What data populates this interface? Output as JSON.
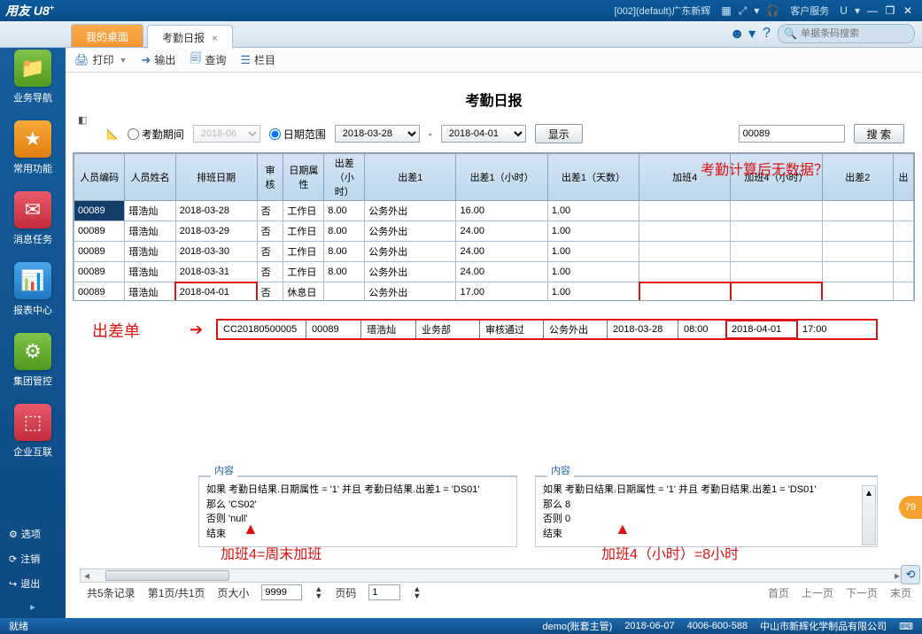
{
  "titlebar": {
    "brand": "用友",
    "brand2": "U8",
    "plus": "+",
    "org_info": "[002](default)广东新辉",
    "service": "客户服务",
    "u_letter": "U"
  },
  "tabs": {
    "desktop": "我的桌面",
    "report": "考勤日报"
  },
  "search_placeholder": "单据条码搜索",
  "leftnav": {
    "biz": "业务导航",
    "fav": "常用功能",
    "msg": "消息任务",
    "rpt": "报表中心",
    "grp": "集团管控",
    "ent": "企业互联",
    "opt": "选项",
    "logout": "注销",
    "exit": "退出"
  },
  "toolbar": {
    "print": "打印",
    "export": "输出",
    "query": "查询",
    "columns": "栏目"
  },
  "page_title": "考勤日报",
  "filter": {
    "period_label": "考勤期间",
    "period_val": "2018-06",
    "daterange_label": "日期范围",
    "date_from": "2018-03-28",
    "date_to": "2018-04-01",
    "dash": "-",
    "show": "显示",
    "search_val": "00089",
    "search_btn": "搜 索"
  },
  "columns": [
    "人员编码",
    "人员姓名",
    "排班日期",
    "审核",
    "日期属性",
    "出差（小时）",
    "出差1",
    "出差1（小时）",
    "出差1（天数）",
    "加班4",
    "加班4（小时）",
    "出差2",
    "出"
  ],
  "rows": [
    {
      "code": "00089",
      "name": "瑨浩灿",
      "date": "2018-03-28",
      "audit": "否",
      "attr": "工作日",
      "h": "8.00",
      "bt1": "公务外出",
      "bt1h": "16.00",
      "bt1d": "1.00",
      "ot4": "",
      "ot4h": "",
      "bt2": ""
    },
    {
      "code": "00089",
      "name": "瑨浩灿",
      "date": "2018-03-29",
      "audit": "否",
      "attr": "工作日",
      "h": "8.00",
      "bt1": "公务外出",
      "bt1h": "24.00",
      "bt1d": "1.00",
      "ot4": "",
      "ot4h": "",
      "bt2": ""
    },
    {
      "code": "00089",
      "name": "瑨浩灿",
      "date": "2018-03-30",
      "audit": "否",
      "attr": "工作日",
      "h": "8.00",
      "bt1": "公务外出",
      "bt1h": "24.00",
      "bt1d": "1.00",
      "ot4": "",
      "ot4h": "",
      "bt2": ""
    },
    {
      "code": "00089",
      "name": "瑨浩灿",
      "date": "2018-03-31",
      "audit": "否",
      "attr": "工作日",
      "h": "8.00",
      "bt1": "公务外出",
      "bt1h": "24.00",
      "bt1d": "1.00",
      "ot4": "",
      "ot4h": "",
      "bt2": ""
    },
    {
      "code": "00089",
      "name": "瑨浩灿",
      "date": "2018-04-01",
      "audit": "否",
      "attr": "休息日",
      "h": "",
      "bt1": "公务外出",
      "bt1h": "17.00",
      "bt1d": "1.00",
      "ot4": "",
      "ot4h": "",
      "bt2": ""
    }
  ],
  "annot": {
    "nodata": "考勤计算后无数据？",
    "trip": "出差单",
    "ot4weekend": "加班4=周末加班",
    "ot4hours": "加班4（小时）=8小时"
  },
  "detail": {
    "doc": "CC20180500005",
    "code": "00089",
    "name": "瑨浩灿",
    "dept": "业务部",
    "status": "审核通过",
    "type": "公务外出",
    "d1": "2018-03-28",
    "t1": "08:00",
    "d2": "2018-04-01",
    "t2": "17:00"
  },
  "panel_title": "内容",
  "code_left": {
    "l1": "如果 考勤日结果.日期属性 = '1' 并且 考勤日结果.出差1 = 'DS01'",
    "l2": "那么   'CS02'",
    "l3": "否则   'null'",
    "l4": "结束"
  },
  "code_right": {
    "l1": "如果 考勤日结果.日期属性 = '1' 并且 考勤日结果.出差1 = 'DS01'",
    "l2": "那么   8",
    "l3": "否则   0",
    "l4": "结束"
  },
  "pagebar": {
    "total": "共5条记录",
    "page": "第1页/共1页",
    "pagesize_lbl": "页大小",
    "pagesize_val": "9999",
    "pageno_lbl": "页码",
    "pageno_val": "1",
    "first": "首页",
    "prev": "上一页",
    "next": "下一页",
    "last": "末页"
  },
  "statusbar": {
    "ready": "就绪",
    "user": "demo(账套主管)",
    "date": "2018-06-07",
    "phone": "4006-600-588",
    "company": "中山市新辉化学制品有限公司"
  },
  "badge": "79"
}
